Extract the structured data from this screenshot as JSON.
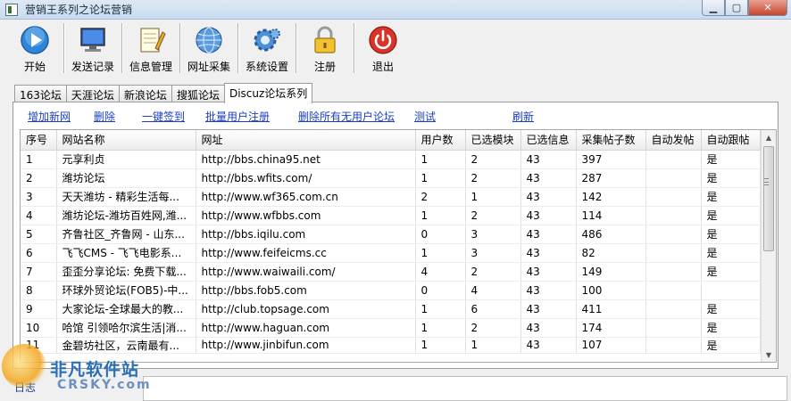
{
  "window": {
    "title": "营销王系列之论坛营销",
    "min": "▁",
    "max": "▢",
    "close": "✕"
  },
  "toolbar": [
    {
      "label": "开始",
      "icon": "play-icon"
    },
    {
      "label": "发送记录",
      "icon": "monitor-icon"
    },
    {
      "label": "信息管理",
      "icon": "notepad-icon"
    },
    {
      "label": "网址采集",
      "icon": "globe-icon"
    },
    {
      "label": "系统设置",
      "icon": "gear-icon"
    },
    {
      "label": "注册",
      "icon": "lock-icon"
    },
    {
      "label": "退出",
      "icon": "power-icon"
    }
  ],
  "tabs": [
    "163论坛",
    "天涯论坛",
    "新浪论坛",
    "搜狐论坛",
    "Discuz论坛系列"
  ],
  "links": [
    "增加新网",
    "删除",
    "一键签到",
    "批量用户注册",
    "删除所有无用户论坛",
    "测试",
    "刷新"
  ],
  "table": {
    "headers": [
      "序号",
      "网站名称",
      "网址",
      "用户数",
      "已选模块",
      "已选信息",
      "采集帖子数",
      "自动发帖",
      "自动跟帖"
    ],
    "rows": [
      [
        "1",
        "元享利贞",
        "http://bbs.china95.net",
        "1",
        "2",
        "43",
        "397",
        "",
        "是"
      ],
      [
        "2",
        "潍坊论坛",
        "http://bbs.wfits.com/",
        "1",
        "2",
        "43",
        "287",
        "",
        "是"
      ],
      [
        "3",
        "天天潍坊 - 精彩生活每...",
        "http://www.wf365.com.cn",
        "2",
        "1",
        "43",
        "142",
        "",
        "是"
      ],
      [
        "4",
        "潍坊论坛-潍坊百姓网,潍...",
        "http://www.wfbbs.com",
        "1",
        "2",
        "43",
        "114",
        "",
        "是"
      ],
      [
        "5",
        "齐鲁社区_齐鲁网 - 山东...",
        "http://bbs.iqilu.com",
        "0",
        "3",
        "43",
        "486",
        "",
        "是"
      ],
      [
        "6",
        "飞飞CMS - 飞飞电影系...",
        "http://www.feifeicms.cc",
        "1",
        "3",
        "43",
        "82",
        "",
        "是"
      ],
      [
        "7",
        "歪歪分享论坛: 免费下载...",
        "http://www.waiwaili.com/",
        "4",
        "2",
        "43",
        "149",
        "",
        "是"
      ],
      [
        "8",
        "环球外贸论坛(FOB5)-中...",
        "http://bbs.fob5.com",
        "0",
        "4",
        "43",
        "100",
        "",
        ""
      ],
      [
        "9",
        "大家论坛-全球最大的教...",
        "http://club.topsage.com",
        "1",
        "6",
        "43",
        "411",
        "",
        "是"
      ],
      [
        "10",
        "哈馆 引领哈尔滨生活|消...",
        "http://www.haguan.com",
        "1",
        "2",
        "43",
        "174",
        "",
        "是"
      ],
      [
        "11",
        "金碧坊社区，云南最有...",
        "http://www.jinbifun.com",
        "1",
        "1",
        "43",
        "107",
        "",
        "是"
      ]
    ]
  },
  "log": {
    "label": "日志"
  },
  "watermark": {
    "cn": "非凡软件站",
    "en": "CRSKY.com"
  },
  "colors": {
    "link": "#1a3fc4",
    "accent": "#2a6fb5"
  }
}
